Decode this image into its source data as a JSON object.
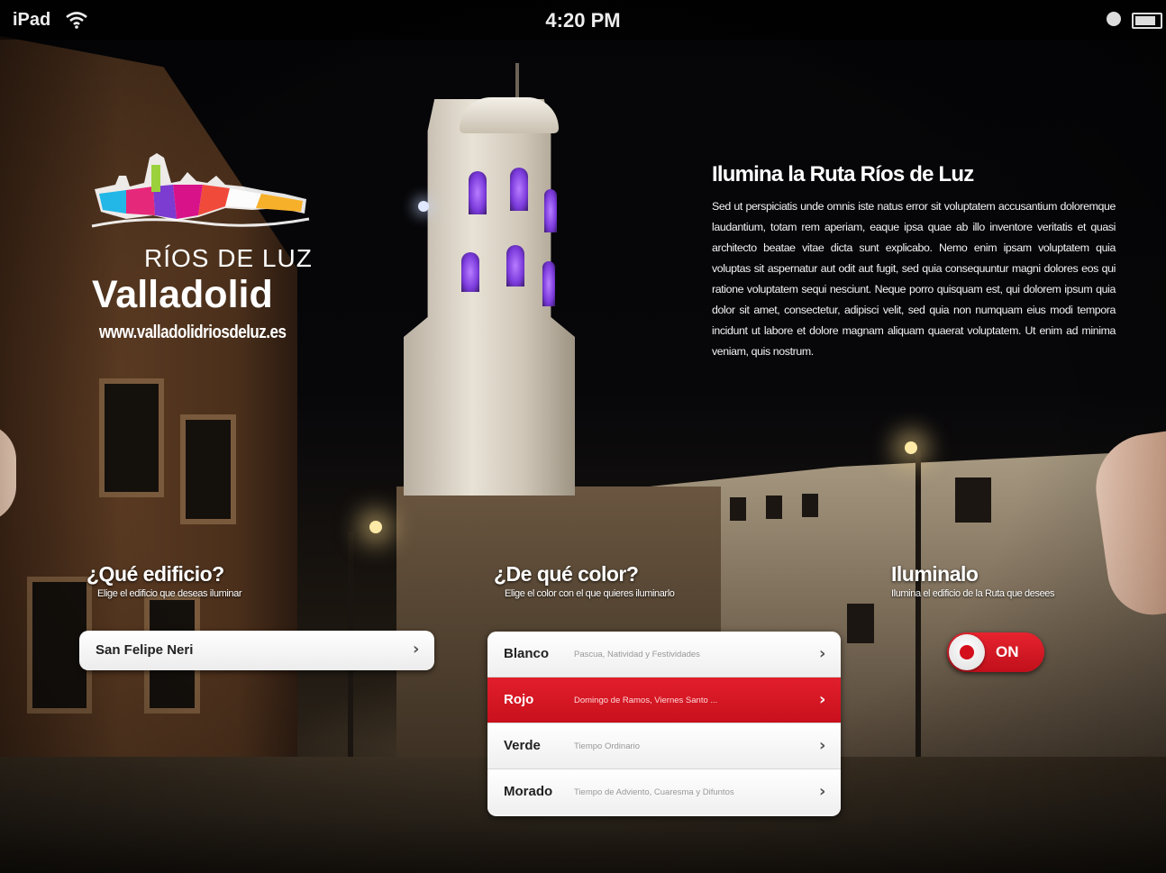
{
  "status_bar": {
    "device": "iPad",
    "time": "4:20 PM"
  },
  "logo": {
    "line1": "RÍOS DE LUZ",
    "line2": "Valladolid",
    "url": "www.valladolidriosdeluz.es"
  },
  "intro": {
    "title": "Ilumina la Ruta Ríos de Luz",
    "body": "Sed ut perspiciatis unde omnis iste natus error sit voluptatem accusantium doloremque laudantium, totam rem aperiam, eaque ipsa quae ab illo inventore veritatis et quasi architecto beatae vitae dicta sunt explicabo. Nemo enim ipsam voluptatem quia voluptas sit aspernatur aut odit aut fugit, sed quia consequuntur magni dolores eos qui ratione voluptatem sequi nesciunt. Neque porro quisquam est, qui dolorem ipsum quia dolor sit amet, consectetur, adipisci velit, sed quia non numquam eius modi tempora incidunt ut labore et dolore magnam aliquam quaerat voluptatem. Ut enim ad minima veniam, quis nostrum."
  },
  "building": {
    "title": "¿Qué edificio?",
    "subtitle": "Elige el edificio que deseas iluminar",
    "selected": "San Felipe Neri"
  },
  "color": {
    "title": "¿De qué color?",
    "subtitle": "Elige el color con el que quieres iluminarlo",
    "options": [
      {
        "name": "Blanco",
        "desc": "Pascua, Natividad y Festividades",
        "selected": false
      },
      {
        "name": "Rojo",
        "desc": "Domingo de Ramos, Viernes Santo ...",
        "selected": true
      },
      {
        "name": "Verde",
        "desc": "Tiempo Ordinario",
        "selected": false
      },
      {
        "name": "Morado",
        "desc": "Tiempo de Adviento, Cuaresma y Difuntos",
        "selected": false
      }
    ],
    "accent": "#d3101b"
  },
  "illuminate": {
    "title": "Iluminalo",
    "subtitle": "Ilumina el edificio de la Ruta que desees",
    "toggle_label": "ON",
    "toggle_on": true
  },
  "icons": {
    "wifi": "wifi-icon",
    "sync": "sync-icon",
    "battery": "battery-icon",
    "chevron": "chevron-right-icon"
  }
}
